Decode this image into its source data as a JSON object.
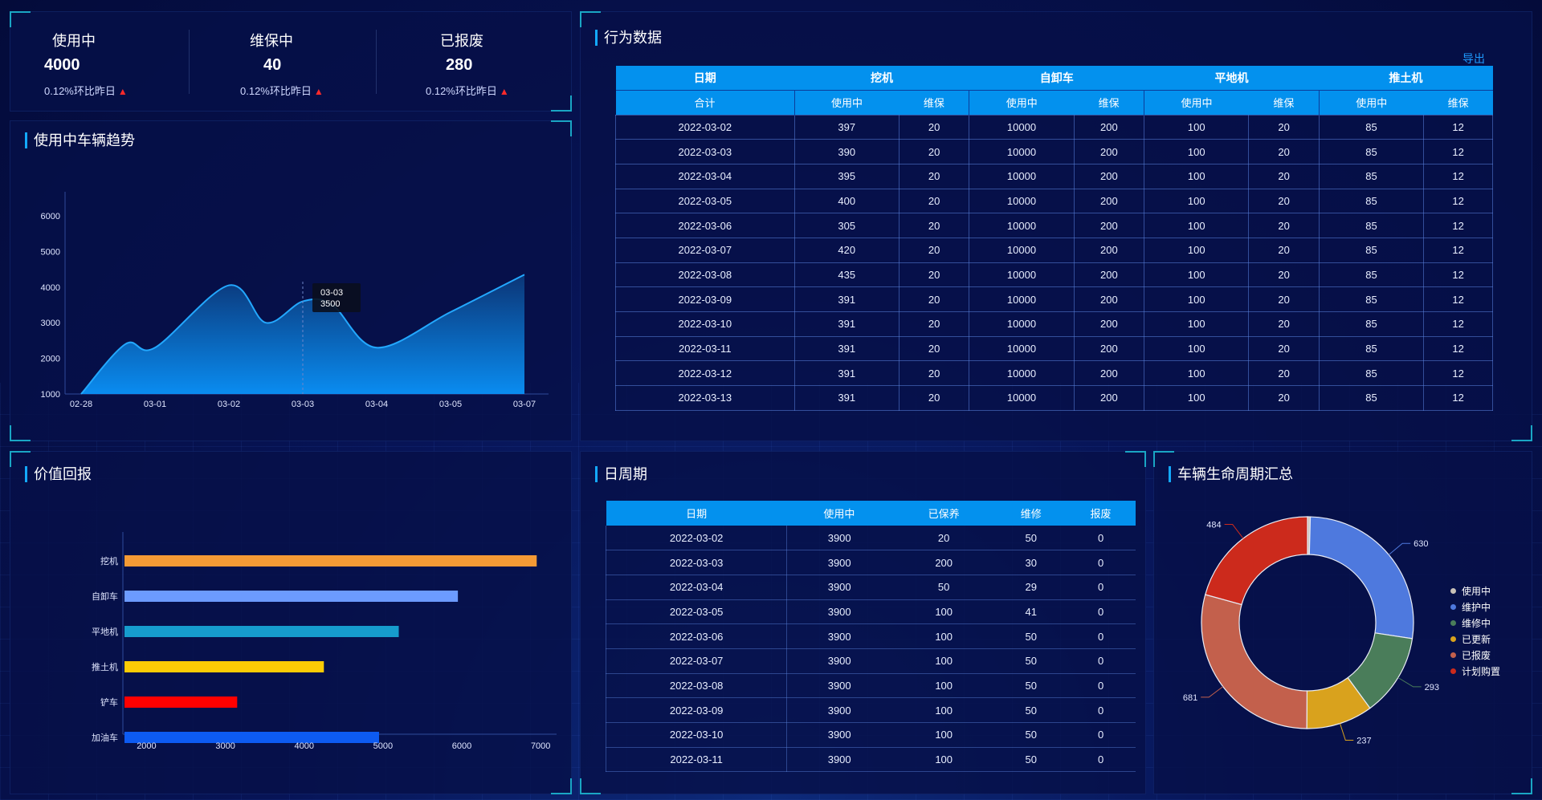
{
  "stats": [
    {
      "label": "使用中",
      "value": "4000",
      "sub": "0.12%环比昨日"
    },
    {
      "label": "维保中",
      "value": "40",
      "sub": "0.12%环比昨日"
    },
    {
      "label": "已报废",
      "value": "280",
      "sub": "0.12%环比昨日"
    }
  ],
  "stat_arrow": "▲",
  "trend": {
    "title": "使用中车辆趋势",
    "tooltip": {
      "date": "03-03",
      "value": "3500"
    },
    "chart_data": {
      "type": "area",
      "categories": [
        "02-28",
        "03-01",
        "03-02",
        "03-03",
        "03-04",
        "03-05",
        "03-07"
      ],
      "x_ticks": [
        "02-28",
        "03-01",
        "03-02",
        "03-03",
        "03-04",
        "03-05",
        "03-07"
      ],
      "y_ticks": [
        "1000",
        "2000",
        "3000",
        "4000",
        "5000",
        "6000"
      ],
      "ylim": [
        1000,
        6000
      ],
      "points": [
        {
          "x": 0.0,
          "y": 1000
        },
        {
          "x": 0.6,
          "y": 2400
        },
        {
          "x": 1.0,
          "y": 2300
        },
        {
          "x": 2.0,
          "y": 4050
        },
        {
          "x": 2.5,
          "y": 3000
        },
        {
          "x": 3.0,
          "y": 3600
        },
        {
          "x": 3.4,
          "y": 3500
        },
        {
          "x": 4.0,
          "y": 2300
        },
        {
          "x": 5.0,
          "y": 3300
        },
        {
          "x": 6.0,
          "y": 4350
        }
      ]
    }
  },
  "behavior": {
    "title": "行为数据",
    "export_label": "导出",
    "head_date": "日期",
    "head_total": "合计",
    "groups": [
      "挖机",
      "自卸车",
      "平地机",
      "推土机"
    ],
    "sub_heads": [
      "使用中",
      "维保"
    ],
    "rows": [
      [
        "2022-03-02",
        "397",
        "20",
        "10000",
        "200",
        "100",
        "20",
        "85",
        "12"
      ],
      [
        "2022-03-03",
        "390",
        "20",
        "10000",
        "200",
        "100",
        "20",
        "85",
        "12"
      ],
      [
        "2022-03-04",
        "395",
        "20",
        "10000",
        "200",
        "100",
        "20",
        "85",
        "12"
      ],
      [
        "2022-03-05",
        "400",
        "20",
        "10000",
        "200",
        "100",
        "20",
        "85",
        "12"
      ],
      [
        "2022-03-06",
        "305",
        "20",
        "10000",
        "200",
        "100",
        "20",
        "85",
        "12"
      ],
      [
        "2022-03-07",
        "420",
        "20",
        "10000",
        "200",
        "100",
        "20",
        "85",
        "12"
      ],
      [
        "2022-03-08",
        "435",
        "20",
        "10000",
        "200",
        "100",
        "20",
        "85",
        "12"
      ],
      [
        "2022-03-09",
        "391",
        "20",
        "10000",
        "200",
        "100",
        "20",
        "85",
        "12"
      ],
      [
        "2022-03-10",
        "391",
        "20",
        "10000",
        "200",
        "100",
        "20",
        "85",
        "12"
      ],
      [
        "2022-03-11",
        "391",
        "20",
        "10000",
        "200",
        "100",
        "20",
        "85",
        "12"
      ],
      [
        "2022-03-12",
        "391",
        "20",
        "10000",
        "200",
        "100",
        "20",
        "85",
        "12"
      ],
      [
        "2022-03-13",
        "391",
        "20",
        "10000",
        "200",
        "100",
        "20",
        "85",
        "12"
      ]
    ]
  },
  "value_return": {
    "title": "价值回报",
    "chart_data": {
      "type": "bar",
      "orientation": "horizontal",
      "categories": [
        "挖机",
        "自卸车",
        "平地机",
        "推土机",
        "铲车",
        "加油车"
      ],
      "values": [
        6950,
        5950,
        5200,
        4250,
        3150,
        4950
      ],
      "colors": [
        "#f59a35",
        "#6c9bff",
        "#169ccd",
        "#fccb05",
        "#ff0000",
        "#0d5bf2"
      ],
      "xlim": [
        1700,
        7100
      ],
      "x_ticks": [
        "2000",
        "3000",
        "4000",
        "5000",
        "6000",
        "7000"
      ]
    }
  },
  "daily": {
    "title": "日周期",
    "headers": [
      "日期",
      "使用中",
      "已保养",
      "维修",
      "报废"
    ],
    "rows": [
      [
        "2022-03-02",
        "3900",
        "20",
        "50",
        "0"
      ],
      [
        "2022-03-03",
        "3900",
        "200",
        "30",
        "0"
      ],
      [
        "2022-03-04",
        "3900",
        "50",
        "29",
        "0"
      ],
      [
        "2022-03-05",
        "3900",
        "100",
        "41",
        "0"
      ],
      [
        "2022-03-06",
        "3900",
        "100",
        "50",
        "0"
      ],
      [
        "2022-03-07",
        "3900",
        "100",
        "50",
        "0"
      ],
      [
        "2022-03-08",
        "3900",
        "100",
        "50",
        "0"
      ],
      [
        "2022-03-09",
        "3900",
        "100",
        "50",
        "0"
      ],
      [
        "2022-03-10",
        "3900",
        "100",
        "50",
        "0"
      ],
      [
        "2022-03-11",
        "3900",
        "100",
        "50",
        "0"
      ]
    ]
  },
  "lifecycle": {
    "title": "车辆生命周期汇总",
    "chart_data": {
      "type": "pie",
      "donut": true,
      "slices": [
        {
          "name": "使用中",
          "value": 10,
          "label": "",
          "color": "#c9c2b8"
        },
        {
          "name": "维护中",
          "value": 630,
          "label": "630",
          "color": "#4e79de"
        },
        {
          "name": "维修中",
          "value": 293,
          "label": "293",
          "color": "#4a7d5a"
        },
        {
          "name": "已更新",
          "value": 237,
          "label": "237",
          "color": "#d9a21d"
        },
        {
          "name": "已报废",
          "value": 681,
          "label": "681",
          "color": "#c3604c"
        },
        {
          "name": "计划购置",
          "value": 484,
          "label": "484",
          "color": "#cc2a1c"
        }
      ],
      "legend_position": "right"
    }
  }
}
